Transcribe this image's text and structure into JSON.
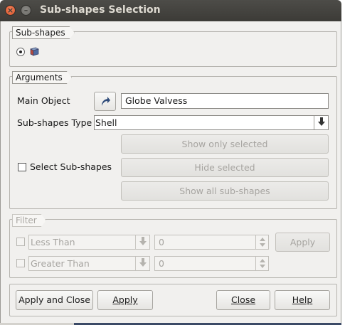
{
  "window": {
    "title": "Sub-shapes Selection"
  },
  "subshapes_group": {
    "legend": "Sub-shapes"
  },
  "arguments_group": {
    "legend": "Arguments",
    "main_object_label": "Main Object",
    "main_object_value": "Globe Valvess",
    "subshapes_type_label": "Sub-shapes Type",
    "subshapes_type_value": "Shell",
    "select_subshapes_label": "Select Sub-shapes",
    "show_only_selected": "Show only selected",
    "hide_selected": "Hide selected",
    "show_all": "Show all sub-shapes"
  },
  "filter_group": {
    "legend": "Filter",
    "less_than_label": "Less Than",
    "less_than_value": "0",
    "greater_than_label": "Greater Than",
    "greater_than_value": "0",
    "apply_label": "Apply"
  },
  "footer": {
    "apply_and_close": "Apply and Close",
    "apply": "Apply",
    "close": "Close",
    "help": "Help"
  }
}
